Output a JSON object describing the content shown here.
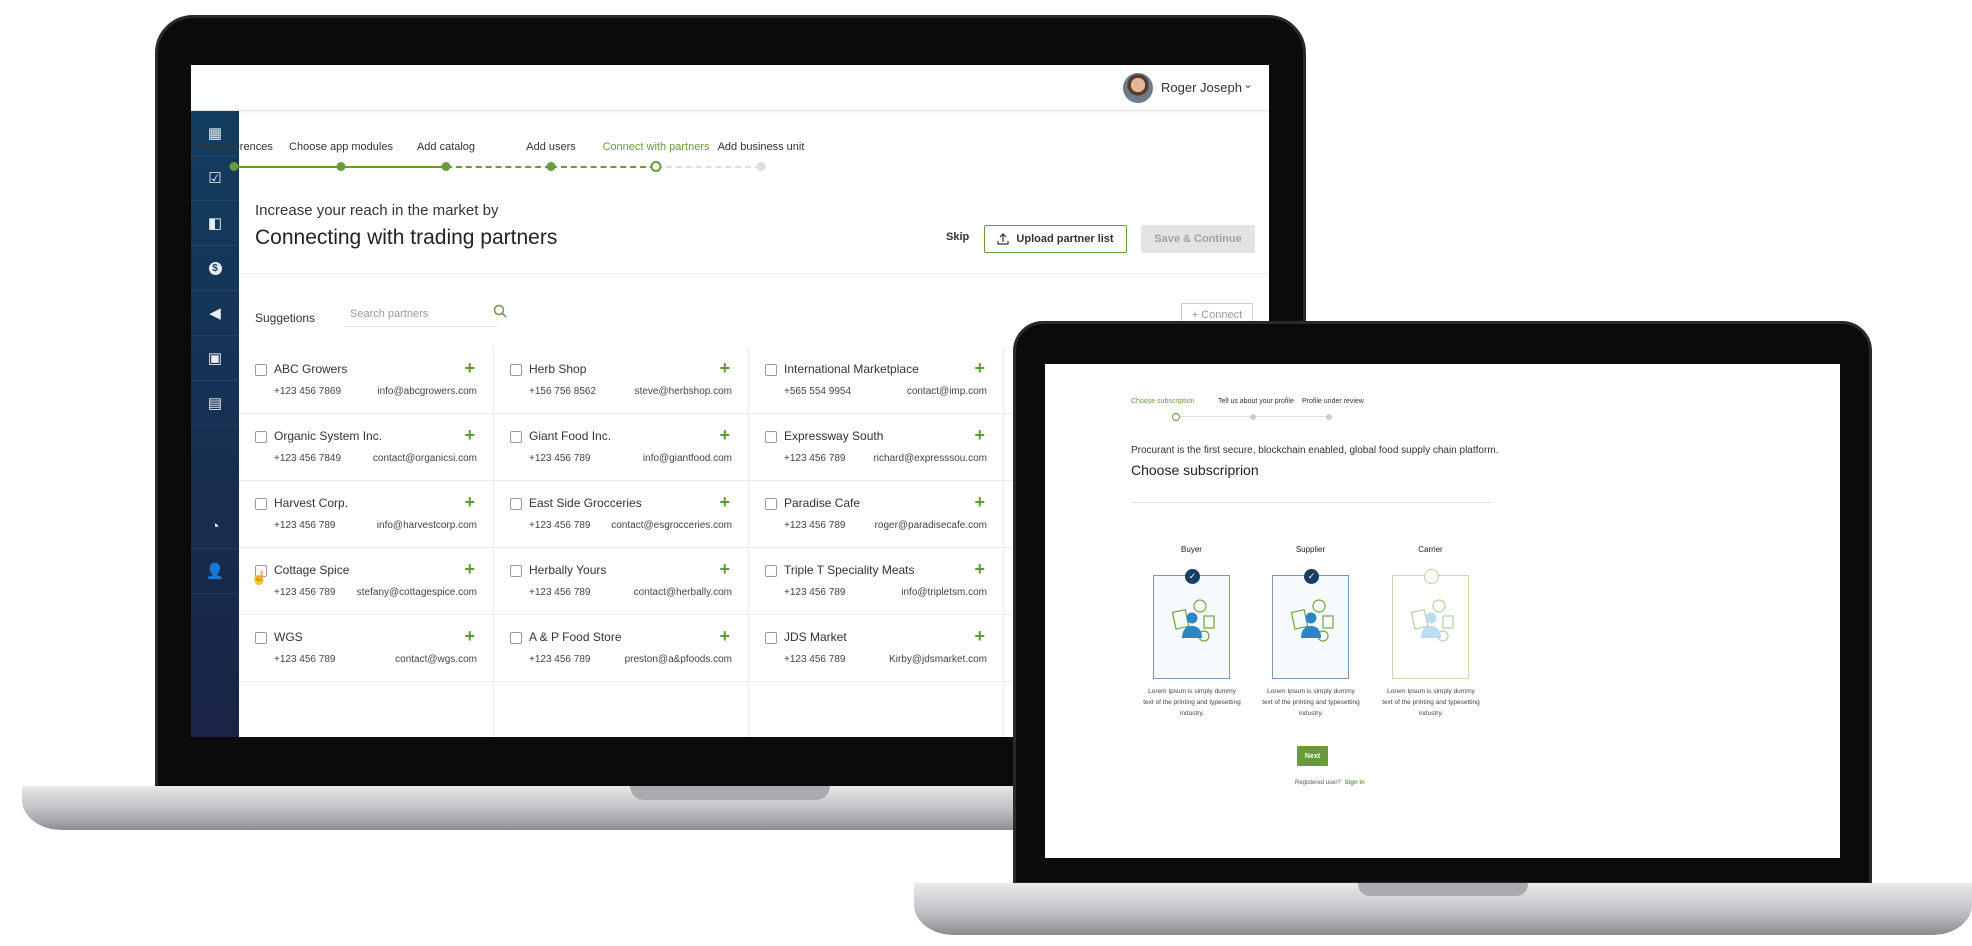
{
  "colors": {
    "accent": "#6a9a3c",
    "sidebar": "#123d5f",
    "selected_badge": "#173e63"
  },
  "app1": {
    "user": {
      "name": "Roger Joseph",
      "menu_icon": "chevron-down-icon"
    },
    "sidebar": {
      "items": [
        {
          "icon": "dashboard-icon"
        },
        {
          "icon": "clipboard-check-icon"
        },
        {
          "icon": "shopping-bag-icon"
        },
        {
          "icon": "dollar-coin-icon"
        },
        {
          "icon": "megaphone-icon"
        },
        {
          "icon": "wallet-icon"
        },
        {
          "icon": "document-icon"
        },
        {
          "icon": "pie-chart-icon"
        },
        {
          "icon": "user-settings-icon"
        }
      ]
    },
    "stepper": [
      {
        "label": "Set preferences",
        "state": "done"
      },
      {
        "label": "Choose app modules",
        "state": "done"
      },
      {
        "label": "Add catalog",
        "state": "done"
      },
      {
        "label": "Add users",
        "state": "done"
      },
      {
        "label": "Connect with partners",
        "state": "current"
      },
      {
        "label": "Add business unit",
        "state": "pending"
      }
    ],
    "header": {
      "subtitle": "Increase your reach in the market by",
      "title": "Connecting with trading partners",
      "skip": "Skip",
      "upload": "Upload partner list",
      "save": "Save & Continue"
    },
    "suggestions": {
      "label": "Suggetions",
      "search_placeholder": "Search partners",
      "connect": "+ Connect"
    },
    "partners": [
      {
        "name": "ABC Growers",
        "phone": "+123 456 7869",
        "email": "info@abcgrowers.com"
      },
      {
        "name": "Herb Shop",
        "phone": "+156 756 8562",
        "email": "steve@herbshop.com"
      },
      {
        "name": "International Marketplace",
        "phone": "+565 554 9954",
        "email": "contact@imp.com"
      },
      {
        "name": "Organic System Inc.",
        "phone": "+123 456 7849",
        "email": "contact@organicsi.com"
      },
      {
        "name": "Giant Food Inc.",
        "phone": "+123 456 789",
        "email": "info@giantfood.com"
      },
      {
        "name": "Expressway South",
        "phone": "+123 456 789",
        "email": "richard@expresssou.com"
      },
      {
        "name": "Harvest Corp.",
        "phone": "+123 456 789",
        "email": "info@harvestcorp.com"
      },
      {
        "name": "East Side Grocceries",
        "phone": "+123 456 789",
        "email": "contact@esgrocceries.com"
      },
      {
        "name": "Paradise Cafe",
        "phone": "+123 456 789",
        "email": "roger@paradisecafe.com"
      },
      {
        "name": "Cottage Spice",
        "phone": "+123 456 789",
        "email": "stefany@cottagespice.com"
      },
      {
        "name": "Herbally Yours",
        "phone": "+123 456 789",
        "email": "contact@herbally.com"
      },
      {
        "name": "Triple T Speciality Meats",
        "phone": "+123 456 789",
        "email": "info@tripletsm.com"
      },
      {
        "name": "WGS",
        "phone": "+123 456 789",
        "email": "contact@wgs.com"
      },
      {
        "name": "A & P Food Store",
        "phone": "+123 456 789",
        "email": "preston@a&pfoods.com"
      },
      {
        "name": "JDS Market",
        "phone": "+123 456 789",
        "email": "Kirby@jdsmarket.com"
      }
    ]
  },
  "app2": {
    "stepper": [
      {
        "label": "Choose subscription",
        "state": "current"
      },
      {
        "label": "Tell us about your profile",
        "state": "pending"
      },
      {
        "label": "Profile under review",
        "state": "pending"
      }
    ],
    "intro": "Procurant is the first secure, blockchain enabled, global food supply chain platform.",
    "title": "Choose subscriprion",
    "cards": [
      {
        "title": "Buyer",
        "selected": true,
        "desc": "Lorem Ipsum is simply dummy text of the printing and typesetting industry."
      },
      {
        "title": "Supplier",
        "selected": true,
        "desc": "Lorem Ipsum is simply dummy text of the printing and typesetting industry."
      },
      {
        "title": "Carrier",
        "selected": false,
        "desc": "Lorem Ipsum is simply dummy text of the printing and typesetting industry."
      }
    ],
    "next": "Next",
    "registered": "Registered user?",
    "signin": "Sign in"
  }
}
